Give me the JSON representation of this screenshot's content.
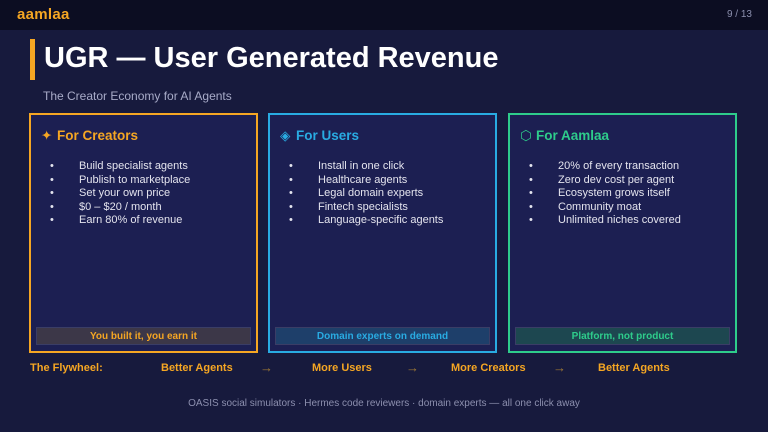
{
  "header": {
    "brand": "aamlaa",
    "pager": "9 / 13"
  },
  "slide": {
    "title": "UGR — User Generated Revenue",
    "subtitle": "The Creator Economy for AI Agents"
  },
  "cards": [
    {
      "icon": "✦",
      "icon_name": "sparkle-icon",
      "title": "For Creators",
      "items": [
        "Build specialist agents",
        "Publish to marketplace",
        "Set your own price",
        "$0 – $20 / month",
        "Earn 80% of revenue"
      ],
      "footer": "You built it, you earn it",
      "color": "#f5a623"
    },
    {
      "icon": "◈",
      "icon_name": "diamond-icon",
      "title": "For Users",
      "items": [
        "Install in one click",
        "Healthcare agents",
        "Legal domain experts",
        "Fintech specialists",
        "Language-specific agents"
      ],
      "footer": "Domain experts on demand",
      "color": "#29abe2"
    },
    {
      "icon": "⬡",
      "icon_name": "hexagon-icon",
      "title": "For Aamlaa",
      "items": [
        "20% of every transaction",
        "Zero dev cost per agent",
        "Ecosystem grows itself",
        "Community moat",
        "Unlimited niches covered"
      ],
      "footer": "Platform, not product",
      "color": "#2ecc8b"
    }
  ],
  "flywheel": {
    "label": "The Flywheel:",
    "steps": [
      "Better Agents",
      "More Users",
      "More Creators",
      "Better Agents"
    ],
    "arrow": "→"
  },
  "footnote": "OASIS social simulators · Hermes code reviewers · domain experts — all one click away",
  "bullet": "•"
}
